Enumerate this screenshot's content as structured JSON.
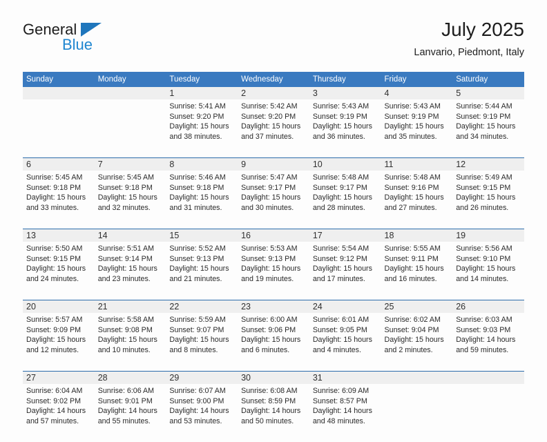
{
  "brand": {
    "name_part1": "General",
    "name_part2": "Blue",
    "accent_color": "#1f76bc"
  },
  "header": {
    "title": "July 2025",
    "subtitle": "Lanvario, Piedmont, Italy"
  },
  "theme": {
    "header_blue": "#3a7ac0",
    "separator_blue": "#2b6cab",
    "daynum_band": "#efefef"
  },
  "weekday_headers": [
    "Sunday",
    "Monday",
    "Tuesday",
    "Wednesday",
    "Thursday",
    "Friday",
    "Saturday"
  ],
  "labels": {
    "sunrise": "Sunrise:",
    "sunset": "Sunset:",
    "daylight": "Daylight:"
  },
  "weeks": [
    [
      {
        "day": "",
        "sunrise": "",
        "sunset": "",
        "daylight": "",
        "daylight2": ""
      },
      {
        "day": "",
        "sunrise": "",
        "sunset": "",
        "daylight": "",
        "daylight2": ""
      },
      {
        "day": "1",
        "sunrise": "Sunrise: 5:41 AM",
        "sunset": "Sunset: 9:20 PM",
        "daylight": "Daylight: 15 hours",
        "daylight2": "and 38 minutes."
      },
      {
        "day": "2",
        "sunrise": "Sunrise: 5:42 AM",
        "sunset": "Sunset: 9:20 PM",
        "daylight": "Daylight: 15 hours",
        "daylight2": "and 37 minutes."
      },
      {
        "day": "3",
        "sunrise": "Sunrise: 5:43 AM",
        "sunset": "Sunset: 9:19 PM",
        "daylight": "Daylight: 15 hours",
        "daylight2": "and 36 minutes."
      },
      {
        "day": "4",
        "sunrise": "Sunrise: 5:43 AM",
        "sunset": "Sunset: 9:19 PM",
        "daylight": "Daylight: 15 hours",
        "daylight2": "and 35 minutes."
      },
      {
        "day": "5",
        "sunrise": "Sunrise: 5:44 AM",
        "sunset": "Sunset: 9:19 PM",
        "daylight": "Daylight: 15 hours",
        "daylight2": "and 34 minutes."
      }
    ],
    [
      {
        "day": "6",
        "sunrise": "Sunrise: 5:45 AM",
        "sunset": "Sunset: 9:18 PM",
        "daylight": "Daylight: 15 hours",
        "daylight2": "and 33 minutes."
      },
      {
        "day": "7",
        "sunrise": "Sunrise: 5:45 AM",
        "sunset": "Sunset: 9:18 PM",
        "daylight": "Daylight: 15 hours",
        "daylight2": "and 32 minutes."
      },
      {
        "day": "8",
        "sunrise": "Sunrise: 5:46 AM",
        "sunset": "Sunset: 9:18 PM",
        "daylight": "Daylight: 15 hours",
        "daylight2": "and 31 minutes."
      },
      {
        "day": "9",
        "sunrise": "Sunrise: 5:47 AM",
        "sunset": "Sunset: 9:17 PM",
        "daylight": "Daylight: 15 hours",
        "daylight2": "and 30 minutes."
      },
      {
        "day": "10",
        "sunrise": "Sunrise: 5:48 AM",
        "sunset": "Sunset: 9:17 PM",
        "daylight": "Daylight: 15 hours",
        "daylight2": "and 28 minutes."
      },
      {
        "day": "11",
        "sunrise": "Sunrise: 5:48 AM",
        "sunset": "Sunset: 9:16 PM",
        "daylight": "Daylight: 15 hours",
        "daylight2": "and 27 minutes."
      },
      {
        "day": "12",
        "sunrise": "Sunrise: 5:49 AM",
        "sunset": "Sunset: 9:15 PM",
        "daylight": "Daylight: 15 hours",
        "daylight2": "and 26 minutes."
      }
    ],
    [
      {
        "day": "13",
        "sunrise": "Sunrise: 5:50 AM",
        "sunset": "Sunset: 9:15 PM",
        "daylight": "Daylight: 15 hours",
        "daylight2": "and 24 minutes."
      },
      {
        "day": "14",
        "sunrise": "Sunrise: 5:51 AM",
        "sunset": "Sunset: 9:14 PM",
        "daylight": "Daylight: 15 hours",
        "daylight2": "and 23 minutes."
      },
      {
        "day": "15",
        "sunrise": "Sunrise: 5:52 AM",
        "sunset": "Sunset: 9:13 PM",
        "daylight": "Daylight: 15 hours",
        "daylight2": "and 21 minutes."
      },
      {
        "day": "16",
        "sunrise": "Sunrise: 5:53 AM",
        "sunset": "Sunset: 9:13 PM",
        "daylight": "Daylight: 15 hours",
        "daylight2": "and 19 minutes."
      },
      {
        "day": "17",
        "sunrise": "Sunrise: 5:54 AM",
        "sunset": "Sunset: 9:12 PM",
        "daylight": "Daylight: 15 hours",
        "daylight2": "and 17 minutes."
      },
      {
        "day": "18",
        "sunrise": "Sunrise: 5:55 AM",
        "sunset": "Sunset: 9:11 PM",
        "daylight": "Daylight: 15 hours",
        "daylight2": "and 16 minutes."
      },
      {
        "day": "19",
        "sunrise": "Sunrise: 5:56 AM",
        "sunset": "Sunset: 9:10 PM",
        "daylight": "Daylight: 15 hours",
        "daylight2": "and 14 minutes."
      }
    ],
    [
      {
        "day": "20",
        "sunrise": "Sunrise: 5:57 AM",
        "sunset": "Sunset: 9:09 PM",
        "daylight": "Daylight: 15 hours",
        "daylight2": "and 12 minutes."
      },
      {
        "day": "21",
        "sunrise": "Sunrise: 5:58 AM",
        "sunset": "Sunset: 9:08 PM",
        "daylight": "Daylight: 15 hours",
        "daylight2": "and 10 minutes."
      },
      {
        "day": "22",
        "sunrise": "Sunrise: 5:59 AM",
        "sunset": "Sunset: 9:07 PM",
        "daylight": "Daylight: 15 hours",
        "daylight2": "and 8 minutes."
      },
      {
        "day": "23",
        "sunrise": "Sunrise: 6:00 AM",
        "sunset": "Sunset: 9:06 PM",
        "daylight": "Daylight: 15 hours",
        "daylight2": "and 6 minutes."
      },
      {
        "day": "24",
        "sunrise": "Sunrise: 6:01 AM",
        "sunset": "Sunset: 9:05 PM",
        "daylight": "Daylight: 15 hours",
        "daylight2": "and 4 minutes."
      },
      {
        "day": "25",
        "sunrise": "Sunrise: 6:02 AM",
        "sunset": "Sunset: 9:04 PM",
        "daylight": "Daylight: 15 hours",
        "daylight2": "and 2 minutes."
      },
      {
        "day": "26",
        "sunrise": "Sunrise: 6:03 AM",
        "sunset": "Sunset: 9:03 PM",
        "daylight": "Daylight: 14 hours",
        "daylight2": "and 59 minutes."
      }
    ],
    [
      {
        "day": "27",
        "sunrise": "Sunrise: 6:04 AM",
        "sunset": "Sunset: 9:02 PM",
        "daylight": "Daylight: 14 hours",
        "daylight2": "and 57 minutes."
      },
      {
        "day": "28",
        "sunrise": "Sunrise: 6:06 AM",
        "sunset": "Sunset: 9:01 PM",
        "daylight": "Daylight: 14 hours",
        "daylight2": "and 55 minutes."
      },
      {
        "day": "29",
        "sunrise": "Sunrise: 6:07 AM",
        "sunset": "Sunset: 9:00 PM",
        "daylight": "Daylight: 14 hours",
        "daylight2": "and 53 minutes."
      },
      {
        "day": "30",
        "sunrise": "Sunrise: 6:08 AM",
        "sunset": "Sunset: 8:59 PM",
        "daylight": "Daylight: 14 hours",
        "daylight2": "and 50 minutes."
      },
      {
        "day": "31",
        "sunrise": "Sunrise: 6:09 AM",
        "sunset": "Sunset: 8:57 PM",
        "daylight": "Daylight: 14 hours",
        "daylight2": "and 48 minutes."
      },
      {
        "day": "",
        "sunrise": "",
        "sunset": "",
        "daylight": "",
        "daylight2": ""
      },
      {
        "day": "",
        "sunrise": "",
        "sunset": "",
        "daylight": "",
        "daylight2": ""
      }
    ]
  ]
}
